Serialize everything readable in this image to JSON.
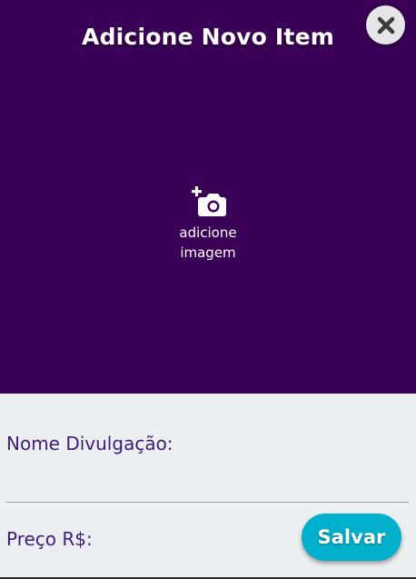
{
  "header": {
    "title": "Adicione Novo Item",
    "background_color": "#3b0057",
    "close_icon": "close-icon"
  },
  "image_picker": {
    "icon": "add-camera-icon",
    "label_line1": "adicione",
    "label_line2": "imagem"
  },
  "form": {
    "background_color": "#eceff1",
    "name_label": "Nome Divulgação:",
    "name_value": "",
    "price_label": "Preço R$:",
    "price_value": "",
    "label_color": "#3f1b7c"
  },
  "actions": {
    "save_label": "Salvar",
    "save_color": "#00b0cc"
  }
}
